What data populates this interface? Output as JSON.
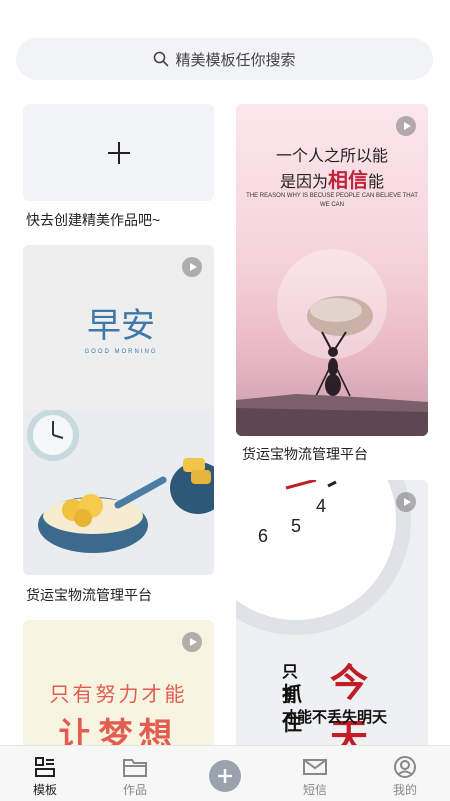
{
  "search": {
    "placeholder": "精美模板任你搜索"
  },
  "create": {
    "label": "快去创建精美作品吧~"
  },
  "cards": [
    {
      "title": "货运宝物流管理平台",
      "image_text": [
        "早安",
        "GOOD MORNING"
      ]
    },
    {
      "title": "货运宝物流管理平台",
      "image_text": [
        "一个人之所以能",
        "是因为",
        "相信",
        "能",
        "THE REASON WHY IS BECUSE PEOPLE CAN BELIEVE THAT WE CAN"
      ]
    },
    {
      "image_text": [
        "只有",
        "今天",
        "抓住",
        "才能不丢失明天"
      ]
    },
    {
      "image_text": [
        "只有努力才能",
        "让梦想"
      ]
    }
  ],
  "tabbar": {
    "items": [
      {
        "label": "模板",
        "icon": "template-icon",
        "active": true
      },
      {
        "label": "作品",
        "icon": "folder-icon"
      },
      {
        "label": "",
        "icon": "add-icon"
      },
      {
        "label": "短信",
        "icon": "message-icon"
      },
      {
        "label": "我的",
        "icon": "profile-icon"
      }
    ]
  },
  "colors": {
    "accent_red": "#c0243a",
    "tab_active": "#222222",
    "tab_inactive": "#888888"
  }
}
